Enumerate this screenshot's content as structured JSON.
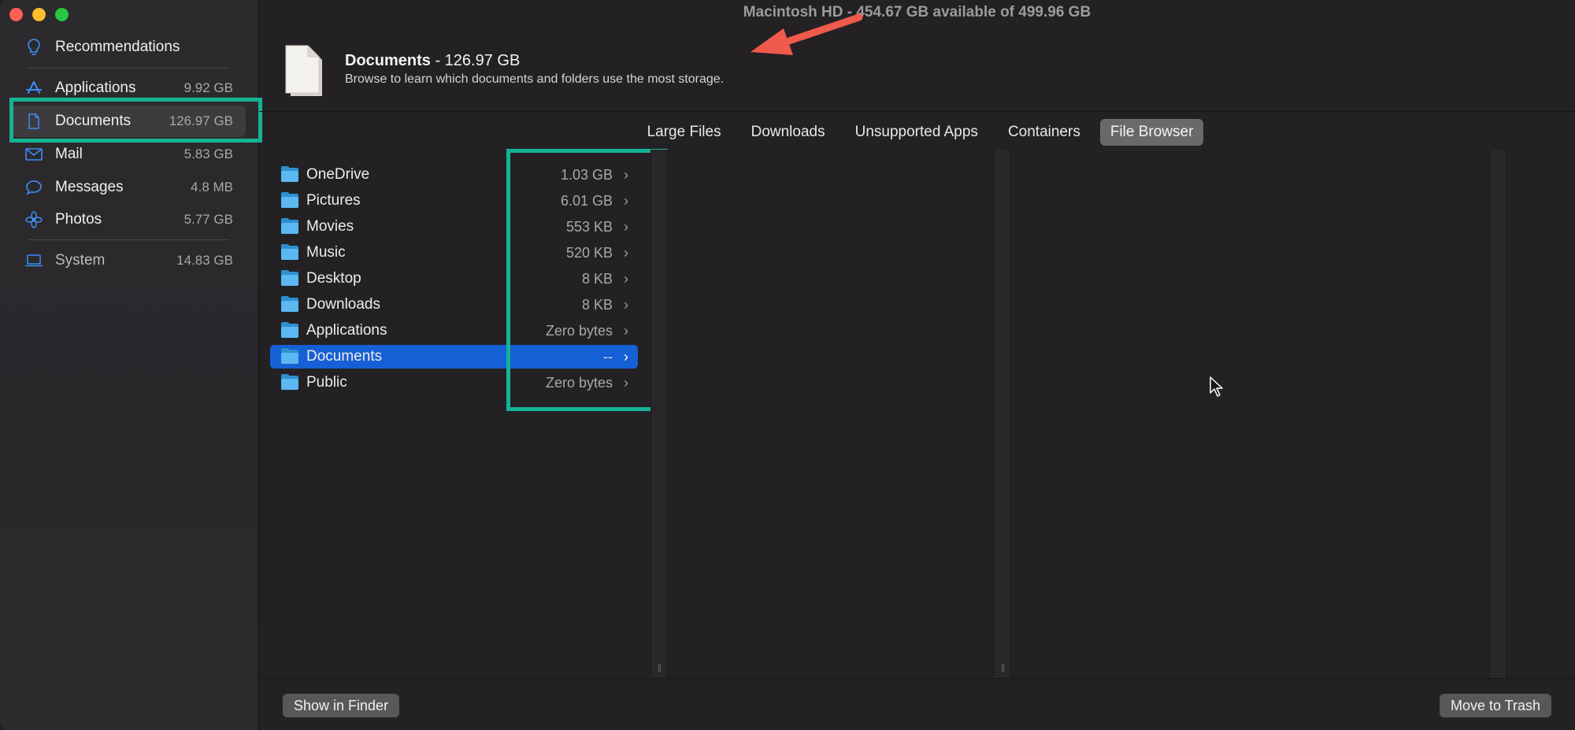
{
  "window": {
    "title": "Macintosh HD - 454.67 GB available of 499.96 GB"
  },
  "sidebar": {
    "items": [
      {
        "label": "Recommendations",
        "size": "",
        "icon": "lightbulb-icon"
      },
      {
        "label": "Applications",
        "size": "9.92 GB",
        "icon": "app-store-icon"
      },
      {
        "label": "Documents",
        "size": "126.97 GB",
        "icon": "document-icon",
        "selected": true
      },
      {
        "label": "Mail",
        "size": "5.83 GB",
        "icon": "envelope-icon"
      },
      {
        "label": "Messages",
        "size": "4.8 MB",
        "icon": "speech-bubble-icon"
      },
      {
        "label": "Photos",
        "size": "5.77 GB",
        "icon": "flower-icon"
      },
      {
        "label": "System",
        "size": "14.83 GB",
        "icon": "laptop-icon"
      }
    ]
  },
  "header": {
    "name": "Documents",
    "size": " - 126.97 GB",
    "subtitle": "Browse to learn which documents and folders use the most storage."
  },
  "tabs": [
    {
      "label": "Large Files"
    },
    {
      "label": "Downloads"
    },
    {
      "label": "Unsupported Apps"
    },
    {
      "label": "Containers"
    },
    {
      "label": "File Browser",
      "active": true
    }
  ],
  "folders": [
    {
      "name": "OneDrive",
      "size": "1.03 GB"
    },
    {
      "name": "Pictures",
      "size": "6.01 GB"
    },
    {
      "name": "Movies",
      "size": "553 KB"
    },
    {
      "name": "Music",
      "size": "520 KB"
    },
    {
      "name": "Desktop",
      "size": "8 KB"
    },
    {
      "name": "Downloads",
      "size": "8 KB"
    },
    {
      "name": "Applications",
      "size": "Zero bytes"
    },
    {
      "name": "Documents",
      "size": "--",
      "selected": true
    },
    {
      "name": "Public",
      "size": "Zero bytes"
    }
  ],
  "footer": {
    "show_in_finder": "Show in Finder",
    "move_to_trash": "Move to Trash"
  },
  "colors": {
    "accent": "#3c8ef5",
    "selection": "#1560d4",
    "annotation_box": "#15b395",
    "annotation_arrow": "#ef5a4c"
  }
}
